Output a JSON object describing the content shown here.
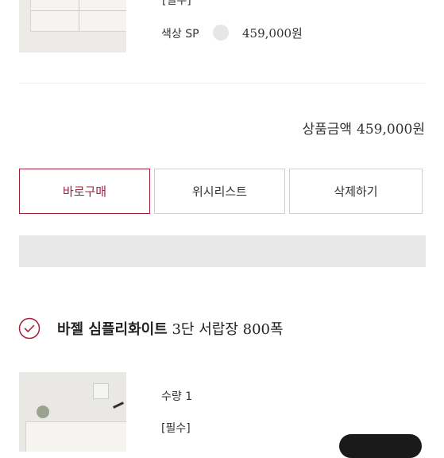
{
  "top_item": {
    "required_label": "[필수]",
    "option_label": "색상 SP",
    "option_price": "459,000원"
  },
  "summary": {
    "total_label": "상품금액",
    "total_amount": "459,000원"
  },
  "actions": {
    "buy_now": "바로구매",
    "wishlist": "위시리스트",
    "delete": "삭제하기"
  },
  "second_item": {
    "brand": "바젤 심플리화이트",
    "name": "3단 서랍장 800폭",
    "quantity_label": "수량 1",
    "required_label": "[필수]"
  },
  "colors": {
    "accent": "#a3213d",
    "swatch": "#e6e6e6",
    "divider": "#eeeeee",
    "grey_bar": "#e8e8e8"
  },
  "icons": {
    "checked": "check-circle-icon"
  }
}
